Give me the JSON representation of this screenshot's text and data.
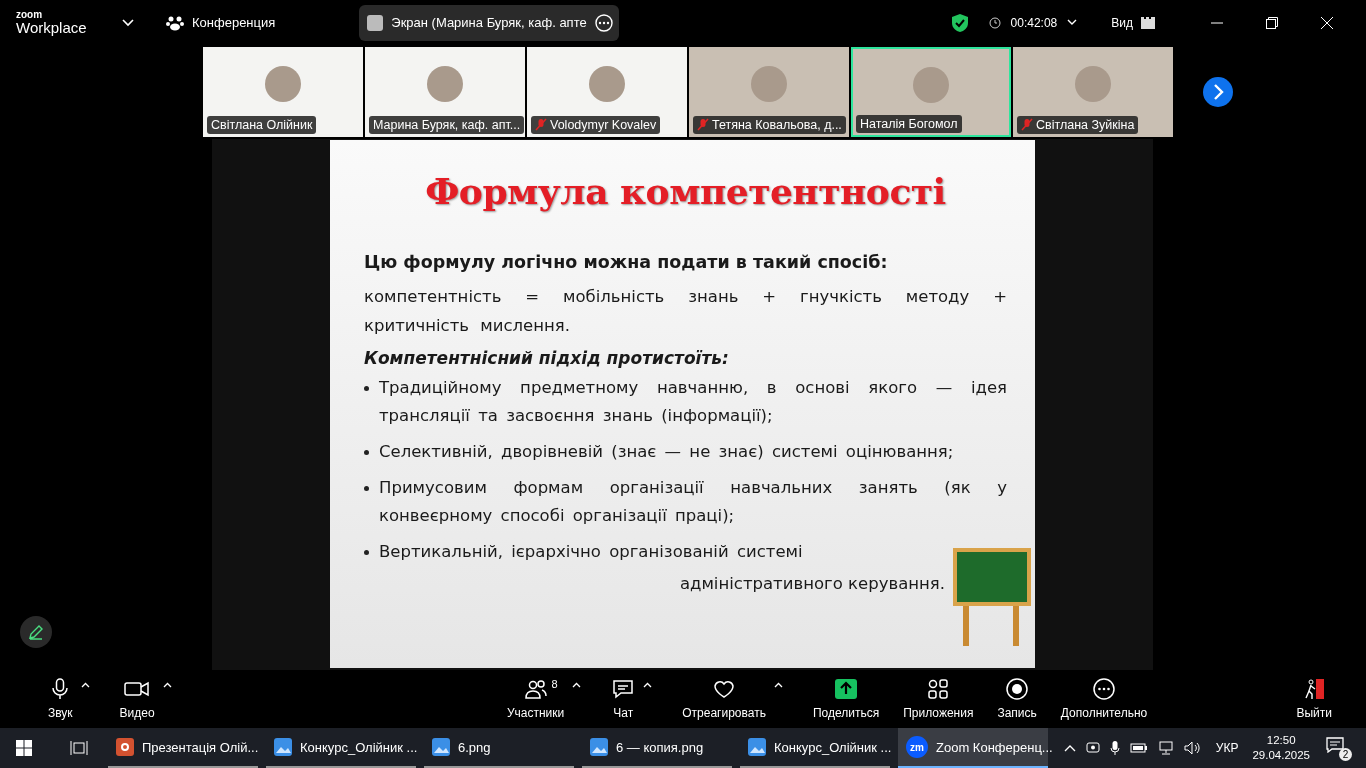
{
  "top_bar": {
    "logo_small": "zoom",
    "logo_large": "Workplace",
    "meeting_label": "Конференция",
    "share_pill": "Экран (Марина Буряк, каф. апте",
    "timer": "00:42:08",
    "view_label": "Вид"
  },
  "participants": [
    {
      "name": "Світлана Олійник",
      "muted": false,
      "speaking": false,
      "kind": "logo"
    },
    {
      "name": "Марина Буряк, каф. апт...",
      "muted": false,
      "speaking": false,
      "kind": "logo"
    },
    {
      "name": "Volodymyr Kovalev",
      "muted": true,
      "speaking": false,
      "kind": "logo"
    },
    {
      "name": "Тетяна Ковальова, д...",
      "muted": true,
      "speaking": false,
      "kind": "photo"
    },
    {
      "name": "Наталія Богомол",
      "muted": false,
      "speaking": true,
      "kind": "photo"
    },
    {
      "name": "Світлана Зуйкіна",
      "muted": true,
      "speaking": false,
      "kind": "photo"
    }
  ],
  "slide": {
    "title": "Формула компетентності",
    "intro": "Цю формулу логічно можна подати в такий спосіб:",
    "formula": "компетентність = мобільність знань + гнучкість методу + критичність мислення.",
    "subheading": "Компетентнісний підхід протистоїть:",
    "bullets": [
      "Традиційному предметному навчанню, в основі якого — ідея трансляції та засвоєння знань (інформації);",
      "Селективній, дворівневій (знає — не знає) системі оцінювання;",
      "Примусовим формам організації навчальних занять (як у конвеєрному способі організації праці);",
      "Вертикальній, ієрархічно організованій системі"
    ],
    "closing_line": "адміністративного керування."
  },
  "toolbar": {
    "left": [
      {
        "kind": "mic",
        "label": "Звук",
        "caret": true
      },
      {
        "kind": "video",
        "label": "Видео",
        "caret": true
      }
    ],
    "center": [
      {
        "kind": "people",
        "label": "Участники",
        "count": "8",
        "caret": true
      },
      {
        "kind": "chat",
        "label": "Чат",
        "caret": true
      },
      {
        "kind": "heart",
        "label": "Отреагировать",
        "caret": true
      },
      {
        "kind": "share",
        "label": "Поделиться",
        "caret": false
      },
      {
        "kind": "apps",
        "label": "Приложения",
        "caret": false
      },
      {
        "kind": "record",
        "label": "Запись",
        "caret": false
      },
      {
        "kind": "more",
        "label": "Дополнительно",
        "caret": false
      }
    ],
    "right": [
      {
        "kind": "leave",
        "label": "Выйти",
        "caret": false
      }
    ]
  },
  "taskbar": {
    "apps": [
      {
        "kind": "ppt",
        "label": "Презентація Олій...",
        "active": false
      },
      {
        "kind": "photo",
        "label": "Конкурс_Олійник ...",
        "active": false
      },
      {
        "kind": "photo",
        "label": "6.png",
        "active": false
      },
      {
        "kind": "photo",
        "label": "6 — копия.png",
        "active": false
      },
      {
        "kind": "photo",
        "label": "Конкурс_Олійник ...",
        "active": false
      },
      {
        "kind": "zoom",
        "label": "Zoom Конференц...",
        "active": true,
        "icon_text": "zm"
      }
    ],
    "lang": "УКР",
    "time": "12:50",
    "date": "29.04.2025",
    "notifications": "2"
  }
}
